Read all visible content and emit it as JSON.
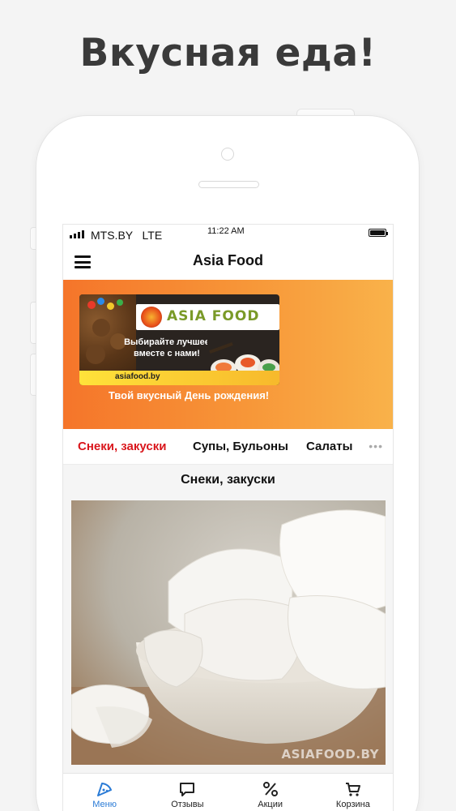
{
  "promo": {
    "headline": "Вкусная еда!"
  },
  "status_bar": {
    "carrier": "MTS.BY   LTE",
    "time": "11:22 AM"
  },
  "nav": {
    "title": "Asia Food"
  },
  "banner": {
    "logo_text": "ASIA FOOD",
    "slogan": "Выбирайте лучшее вместе с нами!",
    "domain": "asiafood.by",
    "caption": "Твой вкусный День рождения!"
  },
  "category_tabs": [
    {
      "label": "Снеки, закуски",
      "active": true
    },
    {
      "label": "Супы, Бульоны",
      "active": false
    },
    {
      "label": "Салаты",
      "active": false
    }
  ],
  "tabs_more_icon": "more-dots-icon",
  "section": {
    "title": "Снеки, закуски",
    "photo_watermark": "ASIAFOOD.BY"
  },
  "tab_bar": [
    {
      "label": "Меню",
      "icon": "pizza-slice-icon",
      "active": true
    },
    {
      "label": "Отзывы",
      "icon": "chat-bubble-icon",
      "active": false
    },
    {
      "label": "Акции",
      "icon": "percent-icon",
      "active": false
    },
    {
      "label": "Корзина",
      "icon": "cart-icon",
      "active": false
    }
  ],
  "colors": {
    "accent_red": "#d9161c",
    "active_blue": "#2a7bd6",
    "banner_orange": "#f5752a"
  }
}
